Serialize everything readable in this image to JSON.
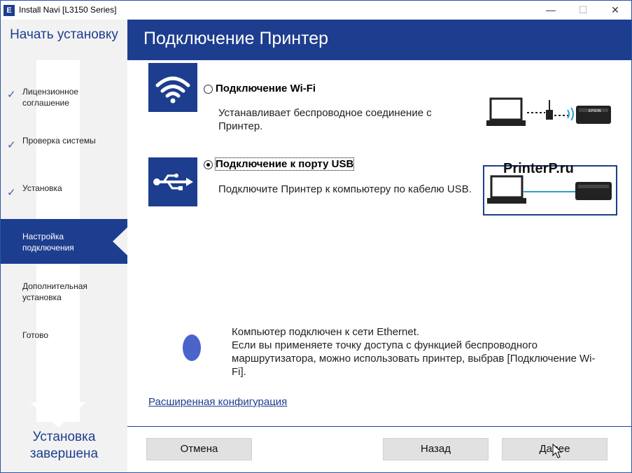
{
  "window": {
    "app_icon_letter": "E",
    "title": "Install Navi [L3150 Series]",
    "controls": {
      "minimize": "—",
      "maximize": "☐",
      "close": "✕"
    }
  },
  "sidebar": {
    "heading": "Начать установку",
    "steps": [
      {
        "label": "Лицензионное соглашение",
        "done": true
      },
      {
        "label": "Проверка системы",
        "done": true
      },
      {
        "label": "Установка",
        "done": true
      },
      {
        "label": "Настройка подключения",
        "active": true
      },
      {
        "label": "Дополнительная установка"
      },
      {
        "label": "Готово"
      }
    ],
    "footer": "Установка завершена",
    "check_glyph": "✓"
  },
  "header": {
    "title": "Подключение Принтер"
  },
  "options": [
    {
      "label": "Подключение Wi-Fi",
      "description": "Устанавливает беспроводное соединение с Принтер.",
      "icon": "wifi-icon",
      "selected": false
    },
    {
      "label": "Подключение к порту USB",
      "description": "Подключите Принтер к компьютеру по кабелю USB.",
      "icon": "usb-icon",
      "selected": true
    }
  ],
  "watermark": "PrinterP.ru",
  "printer_brand": "EPSON",
  "info": {
    "lines": [
      "Компьютер подключен к сети Ethernet.",
      "Если вы применяете точку доступа с функцией беспроводного маршрутизатора, можно использовать принтер, выбрав [Подключение Wi-Fi]."
    ]
  },
  "advanced_link": "Расширенная конфигурация",
  "buttons": {
    "cancel": "Отмена",
    "back": "Назад",
    "next": "Далее"
  },
  "colors": {
    "brand": "#1d3d8f",
    "sidebar_bg": "#f2f2f2",
    "info_dot": "#4a64cc"
  }
}
